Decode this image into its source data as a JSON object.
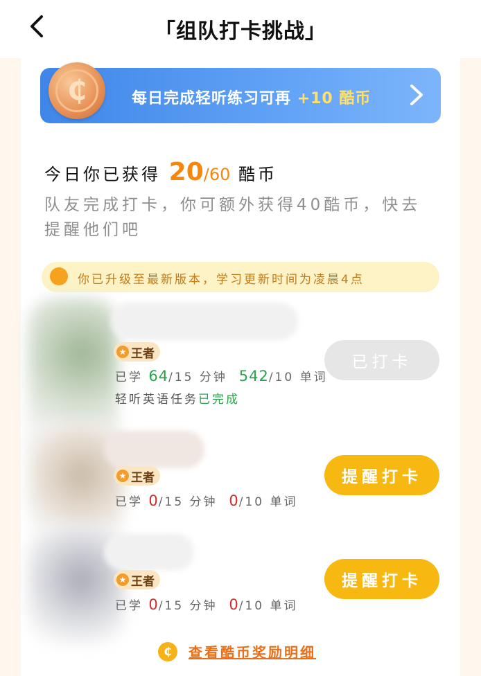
{
  "header": {
    "title": "「组队打卡挑战」",
    "back_icon": "chevron-left-icon"
  },
  "banner": {
    "text": "每日完成轻听练习可再",
    "reward": "+10 酷币",
    "coin_symbol": "₵",
    "colors": {
      "gradient_start": "#3f86e8",
      "gradient_end": "#7db5fb",
      "accent": "#ffe06a"
    }
  },
  "summary": {
    "prefix": "今日你已获得",
    "earned": "20",
    "total": "/60",
    "unit": "酷币",
    "description": "队友完成打卡，你可额外获得40酷币，快去提醒他们吧"
  },
  "notice": {
    "text": "你已升级至最新版本，学习更新时间为凌晨4点"
  },
  "members": [
    {
      "badge": "王者",
      "stat_prefix": "已学",
      "minutes": "64",
      "minutes_suffix": "/15 分钟",
      "words": "542",
      "words_suffix": "/10 单词",
      "task_prefix": "轻听英语任务",
      "task_status": "已完成",
      "button": "已打卡"
    },
    {
      "badge": "王者",
      "stat_prefix": "已学",
      "minutes": "0",
      "minutes_suffix": "/15 分钟",
      "words": "0",
      "words_suffix": "/10 单词",
      "button": "提醒打卡"
    },
    {
      "badge": "王者",
      "stat_prefix": "已学",
      "minutes": "0",
      "minutes_suffix": "/15 分钟",
      "words": "0",
      "words_suffix": "/10 单词",
      "button": "提醒打卡"
    }
  ],
  "footer": {
    "link": "查看酷币奖励明细",
    "coin_symbol": "₵"
  },
  "colors": {
    "page_bg": "#fff7ee",
    "orange": "#f5870f",
    "green": "#2aa24c",
    "red": "#d02a2a",
    "button_yellow": "#f8b812"
  }
}
